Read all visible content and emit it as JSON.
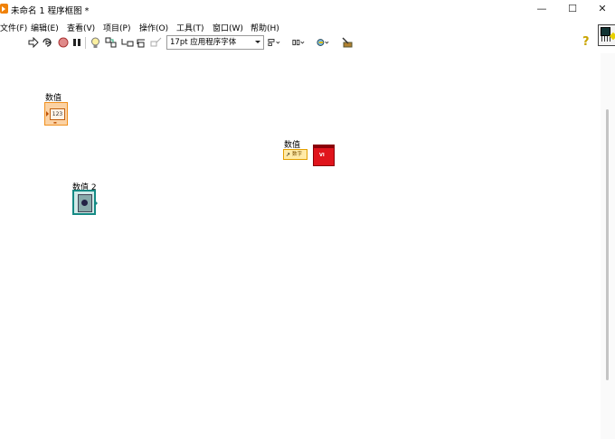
{
  "window": {
    "title": "未命名 1 程序框图 *",
    "minimize_glyph": "—",
    "maximize_glyph": "☐",
    "close_glyph": "✕"
  },
  "menu": [
    {
      "key": "file",
      "label": "文件(F)"
    },
    {
      "key": "edit",
      "label": "编辑(E)"
    },
    {
      "key": "view",
      "label": "查看(V)"
    },
    {
      "key": "project",
      "label": "项目(P)"
    },
    {
      "key": "operate",
      "label": "操作(O)"
    },
    {
      "key": "tools",
      "label": "工具(T)"
    },
    {
      "key": "window",
      "label": "窗口(W)"
    },
    {
      "key": "help",
      "label": "帮助(H)"
    }
  ],
  "toolbar": {
    "font_select": "17pt 应用程序字体",
    "icons": [
      "run-icon",
      "run-continuously-icon",
      "abort-icon",
      "pause-icon",
      "highlight-execution-icon",
      "retain-wire-values-icon",
      "step-into-icon",
      "step-over-icon",
      "step-out-icon",
      "align-objects-icon",
      "distribute-objects-icon",
      "reorder-icon",
      "cleanup-diagram-icon"
    ],
    "context_help_glyph": "?"
  },
  "diagram": {
    "numeric_control": {
      "label": "数值",
      "value_text": "123"
    },
    "property_node": {
      "label": "数值",
      "property": "数字"
    },
    "vi_ref": {
      "text": "VI"
    },
    "control_ref": {
      "label": "数值 2"
    }
  },
  "colors": {
    "numeric_orange": "#f0901e",
    "property_yellow": "#e39f00",
    "vi_red": "#e0141c",
    "ref_teal": "#158a84"
  }
}
